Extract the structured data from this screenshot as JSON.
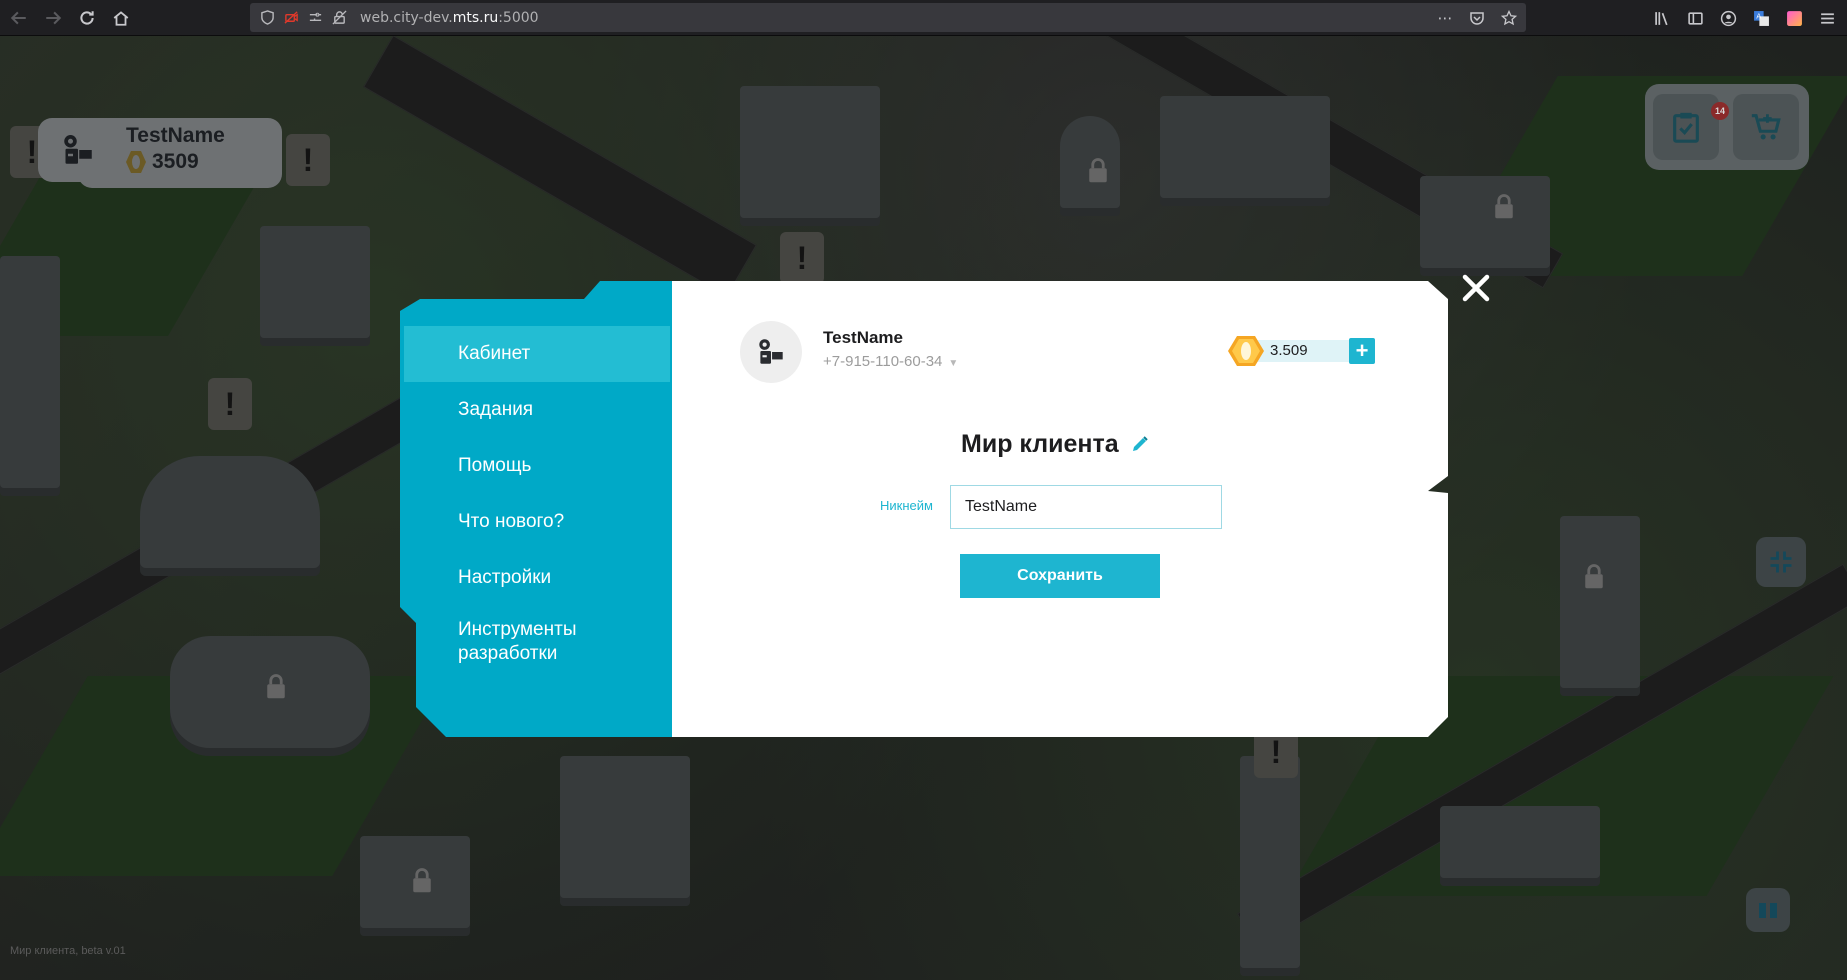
{
  "browser": {
    "url_prefix": "web.city-dev.",
    "url_domain": "mts.ru",
    "url_suffix": ":5000"
  },
  "hud": {
    "player_name": "TestName",
    "coins": "3509",
    "tasks_badge": "14"
  },
  "modal": {
    "menu": [
      {
        "label": "Кабинет",
        "active": true
      },
      {
        "label": "Задания",
        "active": false
      },
      {
        "label": "Помощь",
        "active": false
      },
      {
        "label": "Что нового?",
        "active": false
      },
      {
        "label": "Настройки",
        "active": false
      },
      {
        "label": "Инструменты разработки",
        "active": false
      }
    ],
    "profile": {
      "name": "TestName",
      "phone": "+7-915-110-60-34",
      "balance": "3.509"
    },
    "section_title": "Мир клиента",
    "nickname_label": "Никнейм",
    "nickname_value": "TestName",
    "save_label": "Сохранить"
  },
  "footer": {
    "version_text": "Мир клиента, beta v.01"
  },
  "colors": {
    "accent": "#1eb5d0",
    "sidebar": "#00a9c7",
    "sidebar_active": "#23bdd3"
  }
}
